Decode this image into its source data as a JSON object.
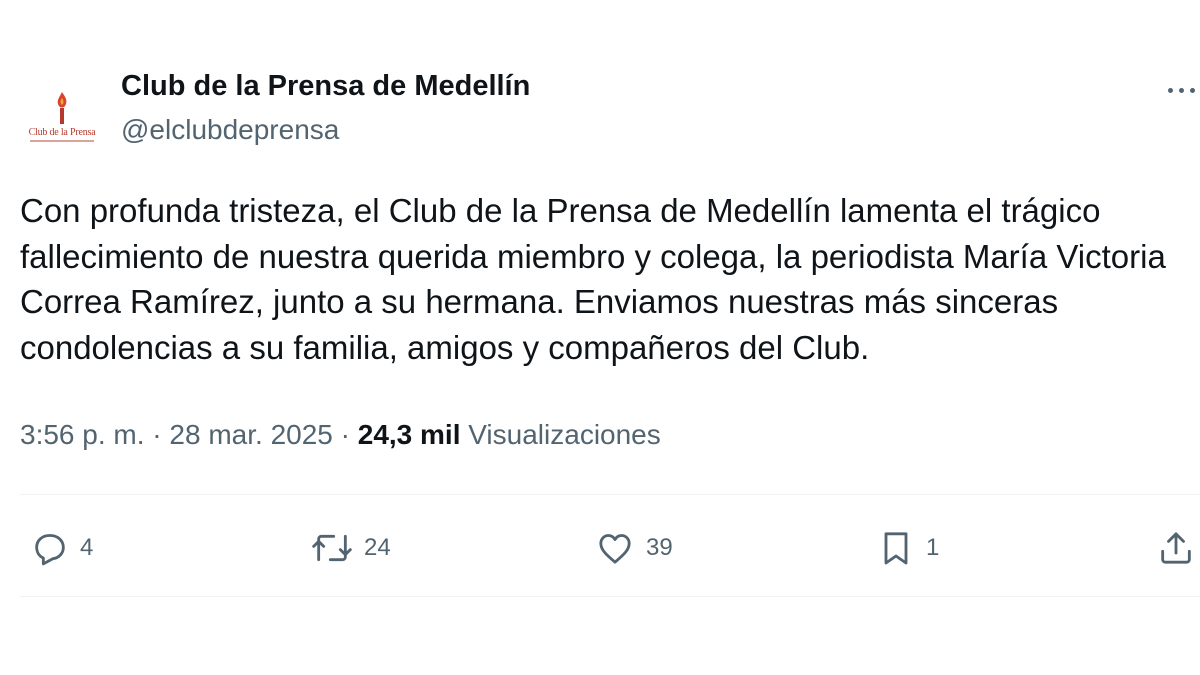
{
  "account": {
    "display_name": "Club de la Prensa de Medellín",
    "handle": "@elclubdeprensa",
    "avatar_text": "Club de la Prensa"
  },
  "tweet": {
    "text": "Con profunda tristeza, el Club de la Prensa de Medellín lamenta el trágico fallecimiento de nuestra querida miembro y colega, la periodista María Victoria Correa Ramírez, junto a su hermana. Enviamos nuestras más sinceras condolencias a su familia, amigos y compañeros del Club.",
    "time": "3:56 p. m.",
    "separator": "·",
    "date": "28 mar. 2025",
    "views_count": "24,3 mil",
    "views_label": "Visualizaciones"
  },
  "actions": {
    "replies": "4",
    "reposts": "24",
    "likes": "39",
    "bookmarks": "1"
  },
  "icons": {
    "reply": "reply-icon",
    "repost": "repost-icon",
    "like": "heart-icon",
    "bookmark": "bookmark-icon",
    "share": "share-icon",
    "more": "more-icon"
  },
  "colors": {
    "text_primary": "#0f1419",
    "text_secondary": "#536471",
    "divider": "#eff3f4",
    "avatar_accent": "#b5392c"
  }
}
